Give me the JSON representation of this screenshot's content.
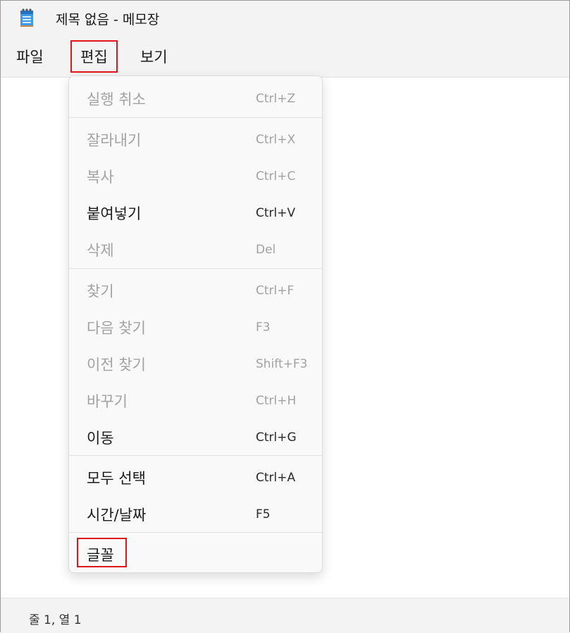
{
  "window": {
    "title": "제목 없음 - 메모장"
  },
  "menubar": {
    "file": "파일",
    "edit": "편집",
    "view": "보기"
  },
  "edit_menu": {
    "undo": {
      "label": "실행 취소",
      "shortcut": "Ctrl+Z"
    },
    "cut": {
      "label": "잘라내기",
      "shortcut": "Ctrl+X"
    },
    "copy": {
      "label": "복사",
      "shortcut": "Ctrl+C"
    },
    "paste": {
      "label": "붙여넣기",
      "shortcut": "Ctrl+V"
    },
    "delete": {
      "label": "삭제",
      "shortcut": "Del"
    },
    "find": {
      "label": "찾기",
      "shortcut": "Ctrl+F"
    },
    "find_next": {
      "label": "다음 찾기",
      "shortcut": "F3"
    },
    "find_prev": {
      "label": "이전 찾기",
      "shortcut": "Shift+F3"
    },
    "replace": {
      "label": "바꾸기",
      "shortcut": "Ctrl+H"
    },
    "goto": {
      "label": "이동",
      "shortcut": "Ctrl+G"
    },
    "select_all": {
      "label": "모두 선택",
      "shortcut": "Ctrl+A"
    },
    "time_date": {
      "label": "시간/날짜",
      "shortcut": "F5"
    },
    "font": {
      "label": "글꼴"
    }
  },
  "statusbar": {
    "position": "줄 1, 열 1"
  },
  "colors": {
    "highlight": "#e0161c",
    "disabled": "#a2a2a2"
  },
  "icons": {
    "app": "notepad-icon"
  }
}
